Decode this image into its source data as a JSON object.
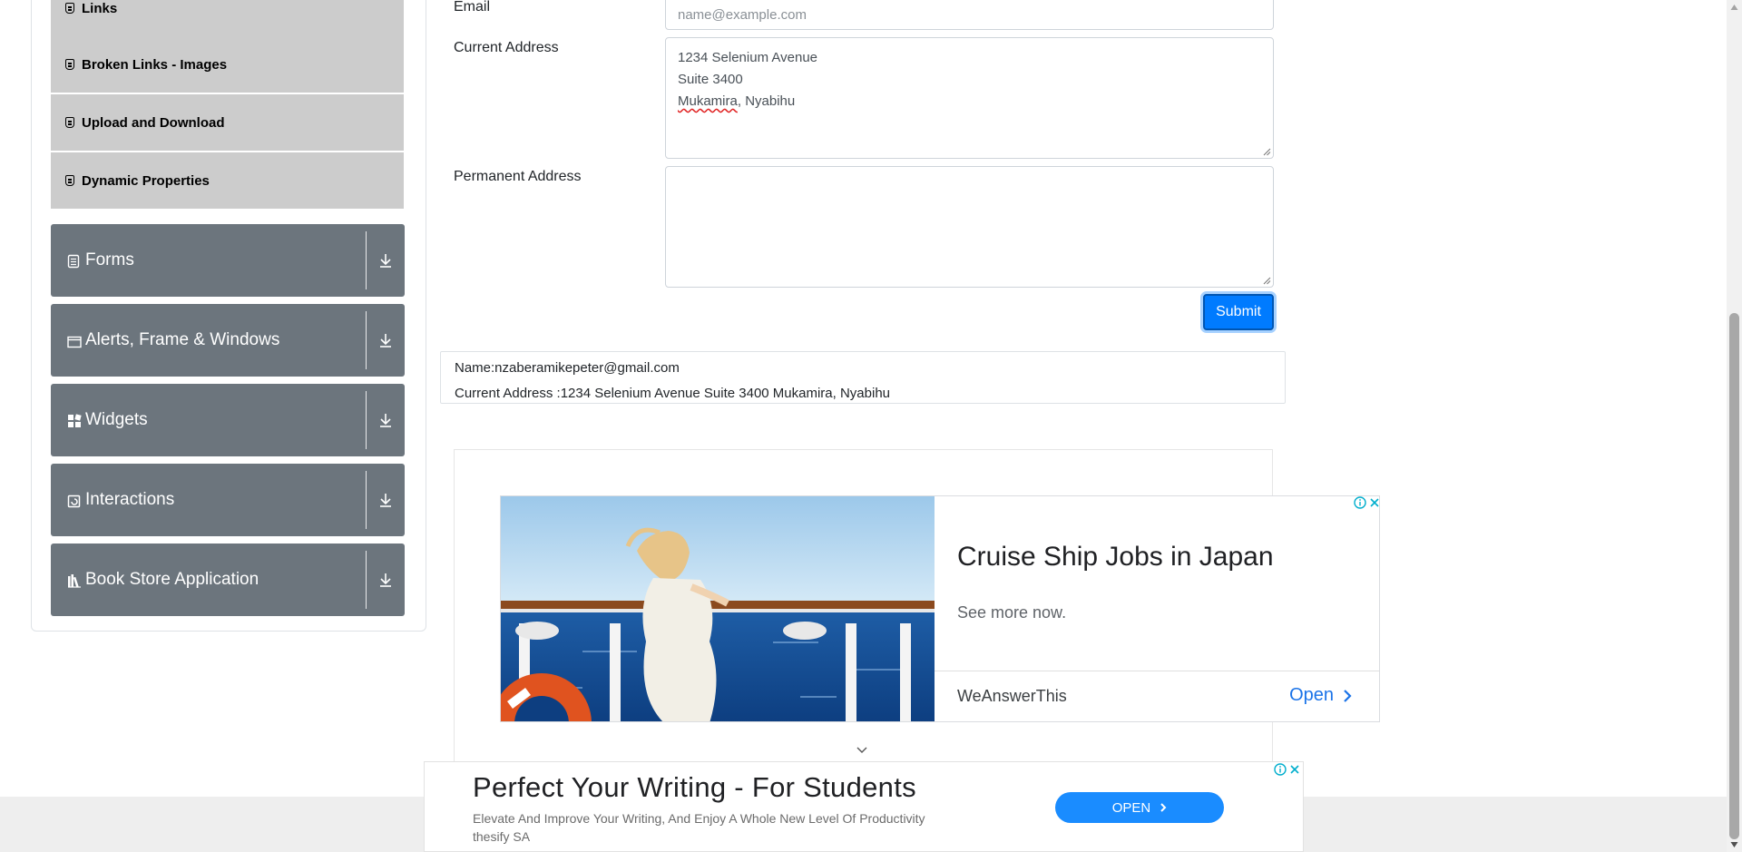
{
  "sidebar": {
    "elements_subitems": [
      {
        "label": "Links",
        "icon": "html5-icon"
      },
      {
        "label": "Broken Links - Images",
        "icon": "html5-icon"
      },
      {
        "label": "Upload and Download",
        "icon": "html5-icon"
      },
      {
        "label": "Dynamic Properties",
        "icon": "html5-icon"
      }
    ],
    "groups": [
      {
        "label": "Forms",
        "icon": "form-icon"
      },
      {
        "label": "Alerts, Frame & Windows",
        "icon": "window-icon"
      },
      {
        "label": "Widgets",
        "icon": "widgets-icon"
      },
      {
        "label": "Interactions",
        "icon": "interactions-icon"
      },
      {
        "label": "Book Store Application",
        "icon": "book-icon"
      }
    ]
  },
  "form": {
    "email_label": "Email",
    "email_placeholder": "name@example.com",
    "current_address_label": "Current Address",
    "current_address_lines": [
      "1234 Selenium Avenue",
      "Suite 3400"
    ],
    "current_address_line3_word": "Mukamira",
    "current_address_line3_rest": ", Nyabihu",
    "permanent_address_label": "Permanent Address",
    "permanent_address_value": "",
    "submit_label": "Submit"
  },
  "output": {
    "name_line": "Name:nzaberamikepeter@gmail.com",
    "address_line": "Current Address :1234 Selenium Avenue Suite 3400 Mukamira, Nyabihu"
  },
  "ad_card": {
    "headline": "Cruise Ship Jobs in Japan",
    "subtext": "See more now.",
    "brand": "WeAnswerThis",
    "open_label": "Open"
  },
  "bottom_ad": {
    "title": "Perfect Your Writing - For Students",
    "description": "Elevate And Improve Your Writing, And Enjoy A Whole New Level Of Productivity",
    "advertiser": "thesify SA",
    "open_label": "OPEN"
  },
  "colors": {
    "submit": "#007bff",
    "group_bg": "#6c757d",
    "subitem_bg": "#cccccc",
    "ad_link": "#1a73e8",
    "bottom_ad_button": "#1a8cff"
  }
}
